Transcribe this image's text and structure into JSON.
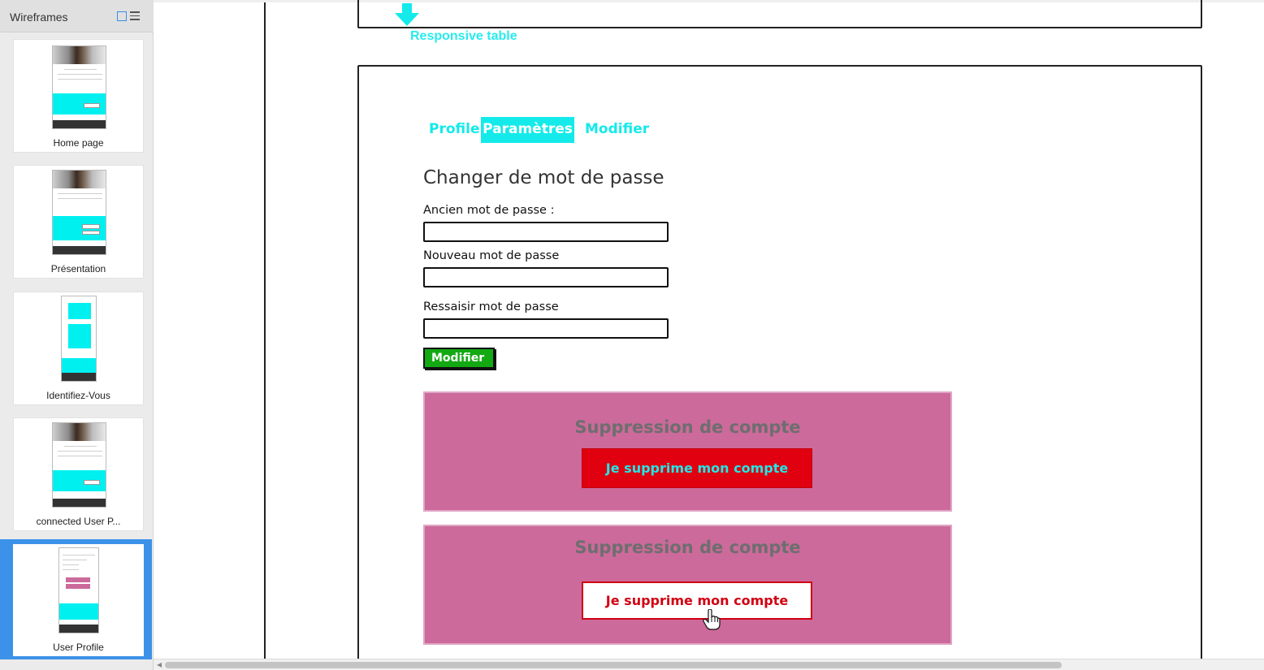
{
  "sidebar": {
    "title": "Wireframes",
    "thumbnails": [
      {
        "caption": "Home page",
        "selected": false
      },
      {
        "caption": "Présentation",
        "selected": false
      },
      {
        "caption": "Identifiez-Vous",
        "selected": false
      },
      {
        "caption": "connected User P...",
        "selected": false
      },
      {
        "caption": "User Profile",
        "selected": true
      }
    ]
  },
  "canvas": {
    "responsive_label": "Responsive table",
    "tabs": {
      "profile": "Profile",
      "params": "Paramètres",
      "modifier": "Modifier"
    },
    "form": {
      "title": "Changer de mot de passe",
      "old_label": "Ancien mot de passe :",
      "new_label": "Nouveau mot de passe",
      "repeat_label": "Ressaisir mot de passe",
      "submit_label": "Modifier"
    },
    "danger_panels": [
      {
        "title": "Suppression de compte",
        "button": "Je supprime mon compte"
      },
      {
        "title": "Suppression de compte",
        "button": "Je supprime mon compte"
      }
    ]
  },
  "colors": {
    "accent_cyan": "#14eaea",
    "submit_green": "#13a913",
    "panel_pink": "#cc6a9b",
    "danger_red": "#e0000f",
    "selection_blue": "#3c92e8"
  }
}
